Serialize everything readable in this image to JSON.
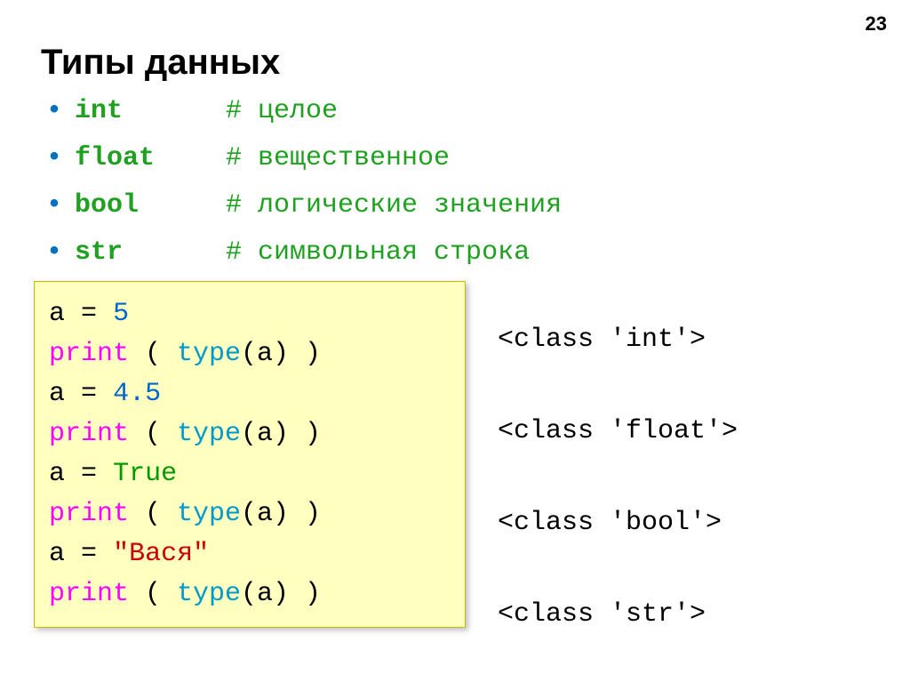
{
  "slide_number": "23",
  "title": "Типы данных",
  "types": [
    {
      "name": "int",
      "comment": "# целое"
    },
    {
      "name": "float",
      "comment": "# вещественное"
    },
    {
      "name": "bool",
      "comment": "# логические значения"
    },
    {
      "name": "str",
      "comment": "# символьная строка"
    }
  ],
  "code": {
    "l1a": "a",
    "l1b": "=",
    "l1c": "5",
    "l2a": "print",
    "l2b": " ( ",
    "l2c": "type",
    "l2d": "(a) )",
    "l3a": "a",
    "l3b": "=",
    "l3c": "4.5",
    "l4a": "print",
    "l4b": " ( ",
    "l4c": "type",
    "l4d": "(a) )",
    "l5a": "a",
    "l5b": "=",
    "l5c": "True",
    "l6a": "print",
    "l6b": " ( ",
    "l6c": "type",
    "l6d": "(a) )",
    "l7a": "a",
    "l7b": "=",
    "l7c": "\"Вася\"",
    "l8a": "print",
    "l8b": " ( ",
    "l8c": "type",
    "l8d": "(a) )"
  },
  "outputs": [
    "<class 'int'>",
    "<class 'float'>",
    "<class 'bool'>",
    "<class 'str'>"
  ]
}
